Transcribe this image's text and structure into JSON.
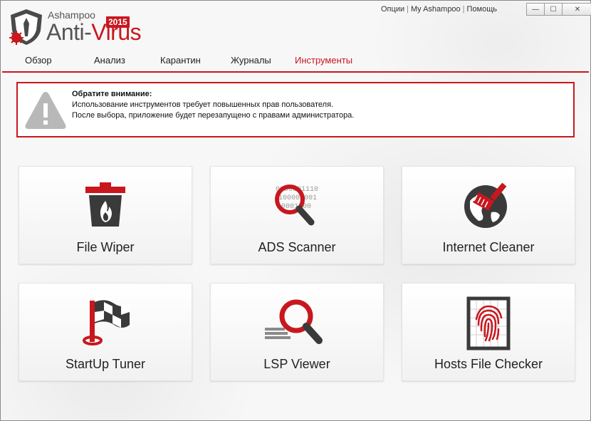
{
  "header": {
    "brand_small": "Ashampoo",
    "brand_anti": "Anti-",
    "brand_virus": "Virus",
    "year": "2015",
    "links": [
      "Опции",
      "My Ashampoo",
      "Помощь"
    ]
  },
  "window_controls": {
    "minimize": "—",
    "maximize": "☐",
    "close": "✕"
  },
  "tabs": [
    {
      "label": "Обзор",
      "active": false
    },
    {
      "label": "Анализ",
      "active": false
    },
    {
      "label": "Карантин",
      "active": false
    },
    {
      "label": "Журналы",
      "active": false
    },
    {
      "label": "Инструменты",
      "active": true
    }
  ],
  "warning": {
    "title": "Обратите внимание:",
    "line1": "Использование инструментов требует повышенных прав пользователя.",
    "line2": "После выбора, приложение будет перезапущено с правами администратора."
  },
  "tools": [
    {
      "label": "File Wiper",
      "icon": "trash-fire-icon"
    },
    {
      "label": "ADS Scanner",
      "icon": "magnifier-binary-icon"
    },
    {
      "label": "Internet Cleaner",
      "icon": "globe-brush-icon"
    },
    {
      "label": "StartUp Tuner",
      "icon": "flag-icon"
    },
    {
      "label": "LSP Viewer",
      "icon": "magnifier-icon"
    },
    {
      "label": "Hosts File Checker",
      "icon": "fingerprint-icon"
    }
  ],
  "binary_text": [
    "0100001110",
    "100001001",
    "10001100"
  ],
  "colors": {
    "accent": "#c8171e",
    "icon_dark": "#3a3a3a",
    "background": "#f7f7f7"
  }
}
